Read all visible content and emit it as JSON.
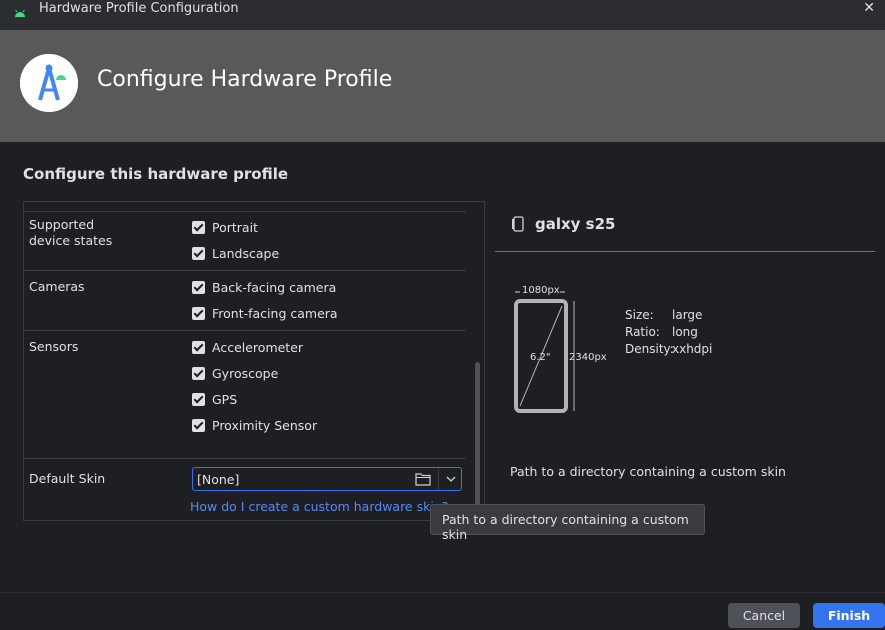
{
  "window": {
    "title": "Hardware Profile Configuration",
    "close_glyph": "✕"
  },
  "header": {
    "title": "Configure Hardware Profile"
  },
  "form": {
    "section_title": "Configure this hardware profile",
    "device_states": {
      "label": "Supported\ndevice states",
      "options": [
        {
          "label": "Portrait",
          "checked": true
        },
        {
          "label": "Landscape",
          "checked": true
        }
      ]
    },
    "cameras": {
      "label": "Cameras",
      "options": [
        {
          "label": "Back-facing camera",
          "checked": true
        },
        {
          "label": "Front-facing camera",
          "checked": true
        }
      ]
    },
    "sensors": {
      "label": "Sensors",
      "options": [
        {
          "label": "Accelerometer",
          "checked": true
        },
        {
          "label": "Gyroscope",
          "checked": true
        },
        {
          "label": "GPS",
          "checked": true
        },
        {
          "label": "Proximity Sensor",
          "checked": true
        }
      ]
    },
    "default_skin": {
      "label": "Default Skin",
      "value": "[None]"
    },
    "skin_help_link": "How do I create a custom hardware skin?"
  },
  "preview": {
    "device_name": "galxy s25",
    "width_px": "1080px",
    "height_px": "2340px",
    "diagonal": "6.2\"",
    "specs": [
      {
        "key": "Size:",
        "value": "large"
      },
      {
        "key": "Ratio:",
        "value": "long"
      },
      {
        "key": "Density:",
        "value": "xxhdpi"
      }
    ],
    "help_text": "Path to a directory containing a custom skin"
  },
  "tooltip": {
    "text": "Path to a directory containing a custom skin"
  },
  "buttons": {
    "cancel": "Cancel",
    "finish": "Finish"
  },
  "colors": {
    "accent": "#3574f0",
    "link": "#548af7",
    "header_bg": "#595959",
    "window_bg": "#1e1f22"
  }
}
